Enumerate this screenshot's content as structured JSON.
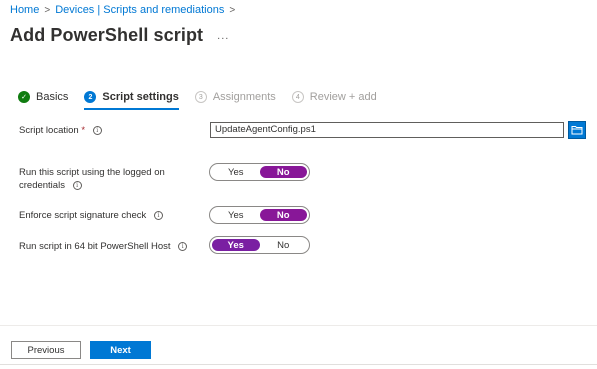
{
  "breadcrumb": {
    "items": [
      "Home",
      "Devices | Scripts and remediations"
    ],
    "separator": ">"
  },
  "header": {
    "title": "Add PowerShell script",
    "more": "..."
  },
  "steps": [
    {
      "number": "1",
      "label": "Basics",
      "state": "completed"
    },
    {
      "number": "2",
      "label": "Script settings",
      "state": "active"
    },
    {
      "number": "3",
      "label": "Assignments",
      "state": "pending"
    },
    {
      "number": "4",
      "label": "Review + add",
      "state": "pending"
    }
  ],
  "form": {
    "script_location": {
      "label": "Script location",
      "required_marker": "*",
      "value": "UpdateAgentConfig.ps1",
      "browse_icon": "folder-icon"
    },
    "run_as_logged_on": {
      "label_line1": "Run this script using the logged on",
      "label_line2": "credentials",
      "options": [
        "Yes",
        "No"
      ],
      "selected": "No"
    },
    "enforce_signature": {
      "label": "Enforce script signature check",
      "options": [
        "Yes",
        "No"
      ],
      "selected": "No"
    },
    "run_64bit": {
      "label": "Run script in 64 bit PowerShell Host",
      "options": [
        "Yes",
        "No"
      ],
      "selected": "Yes"
    }
  },
  "footer": {
    "previous_label": "Previous",
    "next_label": "Next"
  },
  "colors": {
    "accent": "#0078d4",
    "toggle_selected": "#881798",
    "step_done": "#107c10"
  }
}
